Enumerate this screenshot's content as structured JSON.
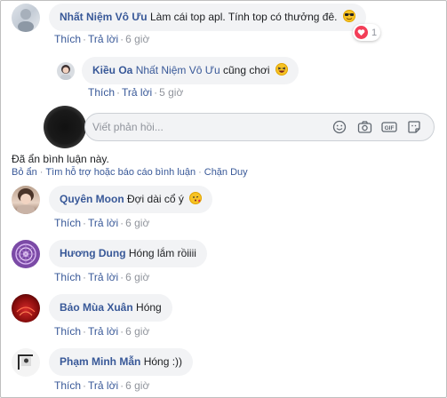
{
  "comments": [
    {
      "author": "Nhất Niệm Vô Ưu",
      "text": "Làm cái top apl. Tính top có thưởng đê.",
      "emoji": "smiling-face-with-sunglasses",
      "reaction_count": "1",
      "actions": {
        "like": "Thích",
        "reply": "Trả lời",
        "time": "6 giờ"
      }
    },
    {
      "author": "Kiều Oa",
      "mention": "Nhất Niệm Vô Ưu",
      "text": "cũng chơi",
      "emoji": "laughing-face",
      "actions": {
        "like": "Thích",
        "reply": "Trả lời",
        "time": "5 giờ"
      }
    },
    {
      "author": "Quyên Moon",
      "text": "Đợi dài cổ ý",
      "emoji": "face-blowing-kiss",
      "actions": {
        "like": "Thích",
        "reply": "Trả lời",
        "time": "6 giờ"
      }
    },
    {
      "author": "Hương Dung",
      "text": "Hóng lắm rồiiii",
      "actions": {
        "like": "Thích",
        "reply": "Trả lời",
        "time": "6 giờ"
      }
    },
    {
      "author": "Bảo Mùa Xuân",
      "text": "Hóng",
      "actions": {
        "like": "Thích",
        "reply": "Trả lời",
        "time": "6 giờ"
      }
    },
    {
      "author": "Phạm Minh Mẫn",
      "text": "Hóng :))",
      "actions": {
        "like": "Thích",
        "reply": "Trả lời",
        "time": "6 giờ"
      }
    }
  ],
  "reply_box": {
    "placeholder": "Viết phản hồi...",
    "tools": [
      "emoji-icon",
      "camera-icon",
      "gif-icon",
      "sticker-icon"
    ]
  },
  "hidden_comment": {
    "message": "Đã ẩn bình luận này.",
    "unhide": "Bỏ ẩn",
    "report": "Tìm hỗ trợ hoặc báo cáo bình luận",
    "block": "Chặn Duy"
  },
  "colors": {
    "name_link": "#385898",
    "bubble_bg": "#f2f3f5",
    "muted": "#90949c",
    "heart": "#f33e58"
  }
}
